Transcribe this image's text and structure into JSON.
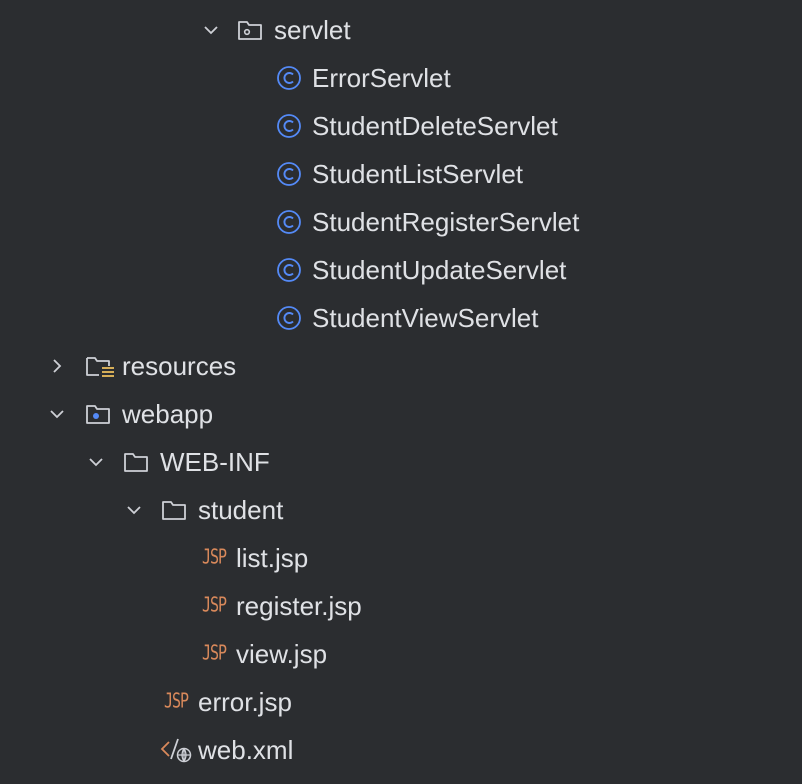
{
  "tree": {
    "servlet": {
      "label": "servlet",
      "icon": "package-folder-icon",
      "state": "expanded"
    },
    "classes": [
      {
        "label": "ErrorServlet",
        "icon": "class-icon"
      },
      {
        "label": "StudentDeleteServlet",
        "icon": "class-icon"
      },
      {
        "label": "StudentListServlet",
        "icon": "class-icon"
      },
      {
        "label": "StudentRegisterServlet",
        "icon": "class-icon"
      },
      {
        "label": "StudentUpdateServlet",
        "icon": "class-icon"
      },
      {
        "label": "StudentViewServlet",
        "icon": "class-icon"
      }
    ],
    "resources": {
      "label": "resources",
      "icon": "resources-folder-icon",
      "state": "collapsed"
    },
    "webapp": {
      "label": "webapp",
      "icon": "web-folder-icon",
      "state": "expanded"
    },
    "web_inf": {
      "label": "WEB-INF",
      "icon": "folder-icon",
      "state": "expanded"
    },
    "student": {
      "label": "student",
      "icon": "folder-icon",
      "state": "expanded"
    },
    "student_files": [
      {
        "label": "list.jsp",
        "badge": "JSP"
      },
      {
        "label": "register.jsp",
        "badge": "JSP"
      },
      {
        "label": "view.jsp",
        "badge": "JSP"
      }
    ],
    "error_jsp": {
      "label": "error.jsp",
      "badge": "JSP"
    },
    "web_xml": {
      "label": "web.xml",
      "icon": "xml-web-icon"
    }
  },
  "colors": {
    "background": "#2b2d30",
    "text": "#dfe1e5",
    "class_icon": "#548af7",
    "jsp_badge": "#d9895b",
    "folder_stroke": "#ced0d6",
    "resources_accent": "#d6ae58"
  }
}
